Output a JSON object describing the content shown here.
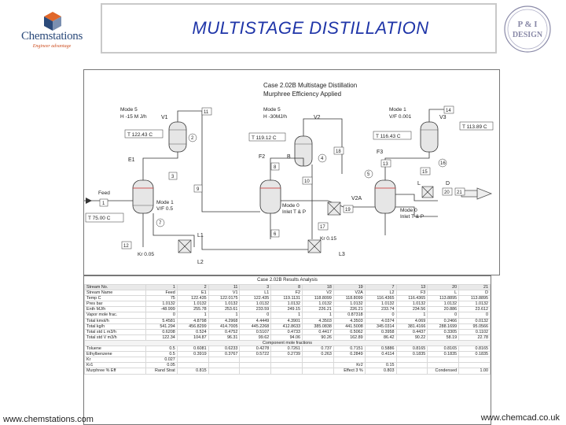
{
  "logo": {
    "brand": "Chemstations",
    "tagline": "Engineer advantage"
  },
  "title": "MULTISTAGE DISTILLATION",
  "stamp": {
    "line1": "P & I",
    "line2": "DESIGN"
  },
  "diagram": {
    "heading1": "Case 2.02B Multistage Distillation",
    "heading2": "Murphree Efficiency Applied",
    "col1_mode": "Mode 5",
    "col1_spec": "H -15 M J/h",
    "col2_mode": "Mode 5",
    "col2_spec": "H -30MJ/h",
    "col3_mode": "Mode 1",
    "col3_spec": "V/F 0.001",
    "temp_v1": "T 122.43 C",
    "temp_v2": "T 119.12 C",
    "temp_v3": "T 116.43 C",
    "temp_feed": "T 75.00 C",
    "temp_right": "T 113.89 C",
    "feed_label": "Feed",
    "mode_feed": "Mode 1",
    "mode_feed_spec": "V/F 0.5",
    "mode0a": "Mode 0",
    "mode0a_spec": "Inlet T & P",
    "mode0b": "Mode 0",
    "mode0b_spec": "Inlet T & P",
    "kr1": "Kr 0.05",
    "kr2": "Kr 0.15",
    "labels": {
      "V1": "V1",
      "V2": "V2",
      "V2A": "V2A",
      "V3": "V3",
      "E1": "E1",
      "F2": "F2",
      "F3": "F3",
      "L1": "L1",
      "L2": "L2",
      "L3": "L3",
      "L": "L",
      "D": "D",
      "B": "B"
    },
    "streams": [
      "1",
      "2",
      "3",
      "4",
      "5",
      "6",
      "7",
      "8",
      "9",
      "10",
      "11",
      "12",
      "13",
      "14",
      "15",
      "16",
      "17",
      "18",
      "19",
      "20",
      "21"
    ]
  },
  "results": {
    "title": "Case 2.02B Results Analysis",
    "header": [
      "Stream No.",
      "1",
      "2",
      "11",
      "3",
      "8",
      "18",
      "19",
      "7",
      "13",
      "20",
      "21"
    ],
    "rows": [
      [
        "Stream Name",
        "Feed",
        "E1",
        "V1",
        "L1",
        "F2",
        "V2",
        "V2A",
        "L2",
        "F3",
        "L",
        "D"
      ],
      [
        "Temp C",
        "75",
        "122.435",
        "122.0175",
        "122.435",
        "119.1131",
        "118.8099",
        "118.8099",
        "116.4365",
        "116.4365",
        "113.8895",
        "113.8895"
      ],
      [
        "Pres bar",
        "1.0132",
        "1.0132",
        "1.0132",
        "1.0132",
        "1.0132",
        "1.0132",
        "1.0132",
        "1.0132",
        "1.0132",
        "1.0132",
        "1.0132"
      ],
      [
        "Enth MJ/h",
        "-48.999",
        "255.78",
        "253.61",
        "233.59",
        "249.15",
        "226.21",
        "226.21",
        "233.74",
        "234.56",
        "20.886",
        "23.612"
      ],
      [
        "Vapor mole frac.",
        "0",
        "1",
        "1",
        "0",
        "1",
        "1",
        "0.87318",
        "0",
        "1",
        "0",
        "0"
      ],
      [
        "Total kmol/h",
        "5.4581",
        "4.8798",
        "4.2968",
        "4.4449",
        "4.3901",
        "4.3503",
        "4.3503",
        "4.0374",
        "4.069",
        "0.2466",
        "0.0132"
      ],
      [
        "Total kg/h",
        "541.294",
        "456.8299",
        "414.7005",
        "445.2268",
        "412.8633",
        "385.0838",
        "441.5008",
        "345.0314",
        "381.4166",
        "288.1699",
        "95.0566"
      ],
      [
        "Total std L m3/h",
        "0.6208",
        "0.524",
        "0.4752",
        "0.5107",
        "0.4733",
        "0.4417",
        "0.5062",
        "0.3958",
        "0.4437",
        "0.3305",
        "0.1102"
      ],
      [
        "Total std V m3/h",
        "122.34",
        "104.87",
        "96.31",
        "99.62",
        "94.06",
        "90.26",
        "162.89",
        "86.42",
        "90.22",
        "58.19",
        "22.78"
      ]
    ],
    "section": "Component mole fractions",
    "comp_rows": [
      [
        "Toluene",
        "0.5",
        "0.6081",
        "0.6233",
        "0.4278",
        "0.7261",
        "0.737",
        "0.7151",
        "0.5886",
        "0.8165",
        "0.8165",
        "0.8165"
      ],
      [
        "Ethylbenzene",
        "0.5",
        "0.3919",
        "0.3767",
        "0.5722",
        "0.2739",
        "0.263",
        "0.2849",
        "0.4114",
        "0.1835",
        "0.1835",
        "0.1835"
      ]
    ],
    "extra_rows": [
      [
        "Kr",
        "0.027",
        "",
        "",
        "",
        "",
        "",
        "",
        "",
        "",
        "",
        ""
      ],
      [
        "Kr1",
        "0.05",
        "",
        "",
        "",
        "",
        "",
        "Kr2",
        "0.15",
        "",
        "",
        ""
      ],
      [
        "Murphree % Eff",
        "Rand Strat",
        "0.815",
        "",
        "",
        "",
        "",
        "Effect 3 %",
        "0.803",
        "",
        "Condensed",
        "1.00"
      ]
    ]
  },
  "footer": {
    "left": "www.chemstations.com",
    "right": "www.chemcad.co.uk"
  }
}
